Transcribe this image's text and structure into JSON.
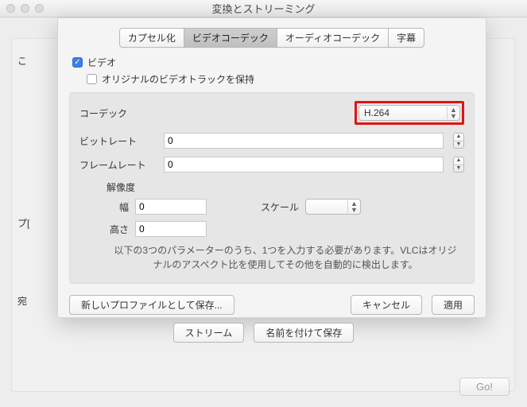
{
  "window": {
    "title": "変換とストリーミング"
  },
  "bg": {
    "label1": "こ",
    "label2": "プ[",
    "label3": "宛"
  },
  "tabs": {
    "items": [
      "カプセル化",
      "ビデオコーデック",
      "オーディオコーデック",
      "字幕"
    ],
    "active": 1
  },
  "video": {
    "check_label": "ビデオ",
    "keep_label": "オリジナルのビデオトラックを保持",
    "codec_label": "コーデック",
    "codec_value": "H.264",
    "bitrate_label": "ビットレート",
    "bitrate_value": "0",
    "framerate_label": "フレームレート",
    "framerate_value": "0",
    "res_label": "解像度",
    "width_label": "幅",
    "width_value": "0",
    "height_label": "高さ",
    "height_value": "0",
    "scale_label": "スケール",
    "scale_value": "",
    "note": "以下の3つのパラメーターのうち、1つを入力する必要があります。VLCはオリジナルのアスペクト比を使用してその他を自動的に検出します。"
  },
  "buttons": {
    "save_profile": "新しいプロファイルとして保存...",
    "cancel": "キャンセル",
    "apply": "適用",
    "stream": "ストリーム",
    "save_as": "名前を付けて保存",
    "go": "Go!"
  }
}
